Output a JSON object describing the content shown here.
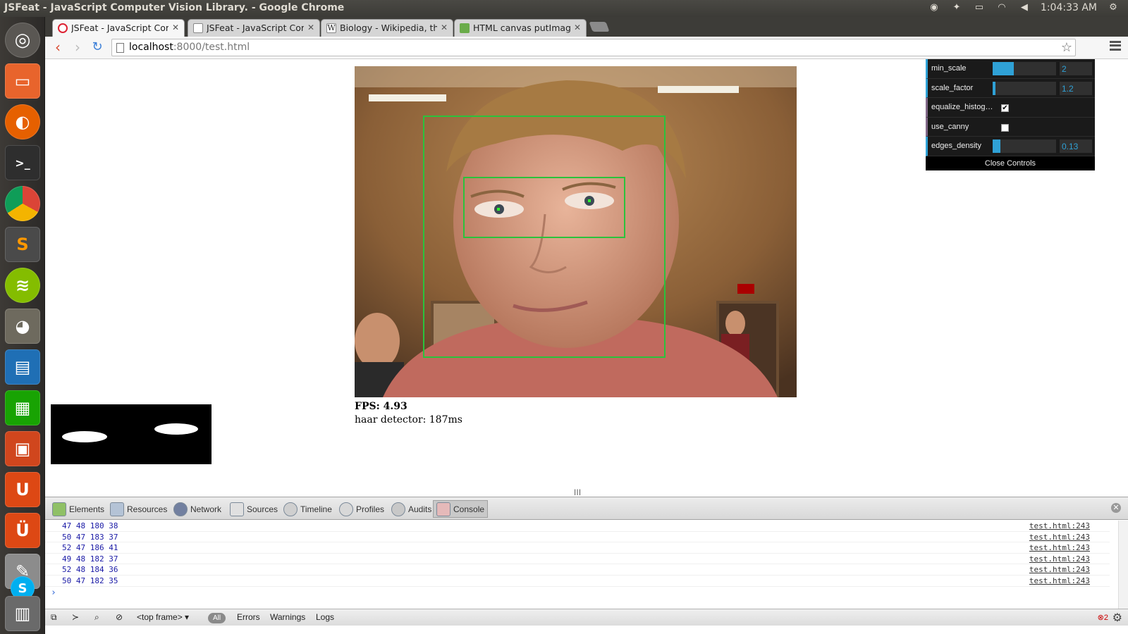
{
  "panel": {
    "window_title": "JSFeat - JavaScript Computer Vision Library. - Google Chrome",
    "clock": "1:04:33 AM"
  },
  "tabs": [
    {
      "label": "JSFeat - JavaScript Computer Vision Library.",
      "active": true
    },
    {
      "label": "JSFeat - JavaScript Computer Vision Library.",
      "active": false
    },
    {
      "label": "Biology - Wikipedia, the free encyclopedia",
      "active": false
    },
    {
      "label": "HTML canvas putImageData",
      "active": false
    }
  ],
  "address": {
    "host": "localhost",
    "path": ":8000/test.html"
  },
  "page": {
    "fps_label": "FPS: 4.93",
    "haar_label": "haar detector: 187ms"
  },
  "gui": {
    "controls": [
      {
        "label": "min_scale",
        "value": "2",
        "fill": 0.33,
        "type": "slider"
      },
      {
        "label": "scale_factor",
        "value": "1.2",
        "fill": 0.04,
        "type": "slider"
      },
      {
        "label": "equalize_histogram",
        "checked": true,
        "type": "checkbox"
      },
      {
        "label": "use_canny",
        "checked": false,
        "type": "checkbox"
      },
      {
        "label": "edges_density",
        "value": "0.13",
        "fill": 0.12,
        "type": "slider"
      }
    ],
    "close_label": "Close Controls"
  },
  "devtools": {
    "tabs": [
      "Elements",
      "Resources",
      "Network",
      "Sources",
      "Timeline",
      "Profiles",
      "Audits",
      "Console"
    ],
    "active_tab": "Console",
    "log_rows": [
      {
        "text": "47 48 180 38",
        "source": "test.html:243"
      },
      {
        "text": "50 47 183 37",
        "source": "test.html:243"
      },
      {
        "text": "52 47 186 41",
        "source": "test.html:243"
      },
      {
        "text": "49 48 182 37",
        "source": "test.html:243"
      },
      {
        "text": "52 48 184 36",
        "source": "test.html:243"
      },
      {
        "text": "50 47 182 35",
        "source": "test.html:243"
      }
    ],
    "prompt": "›",
    "status": {
      "frame_select": "<top frame>",
      "filter_all": "All",
      "filter_errors": "Errors",
      "filter_warnings": "Warnings",
      "filter_logs": "Logs",
      "error_count": "2"
    }
  },
  "colors": {
    "accent": "#2fa1d6",
    "detection": "#2bc23c"
  }
}
